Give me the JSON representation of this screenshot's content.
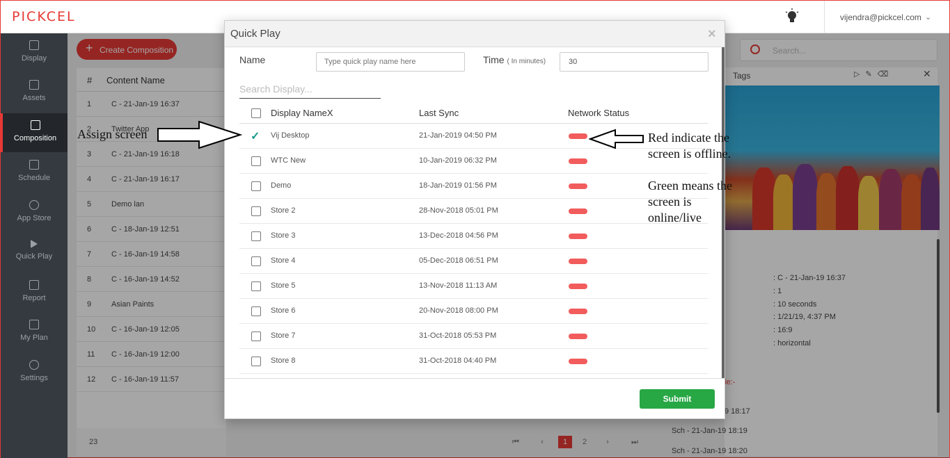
{
  "app": {
    "logo": "PICKCEL",
    "user_email": "vijendra@pickcel.com"
  },
  "sidebar": {
    "items": [
      {
        "label": "Display",
        "icon": "monitor-icon"
      },
      {
        "label": "Assets",
        "icon": "image-icon"
      },
      {
        "label": "Composition",
        "icon": "layout-icon",
        "active": true
      },
      {
        "label": "Schedule",
        "icon": "calendar-icon"
      },
      {
        "label": "App Store",
        "icon": "compass-icon"
      },
      {
        "label": "Quick Play",
        "icon": "play-icon"
      },
      {
        "label": "Report",
        "icon": "report-icon"
      },
      {
        "label": "My Plan",
        "icon": "diamond-icon"
      },
      {
        "label": "Settings",
        "icon": "gear-icon"
      }
    ]
  },
  "background": {
    "create_label": "Create Composition",
    "table_headers": [
      "#",
      "Content Name"
    ],
    "rows": [
      {
        "n": "1",
        "name": "C - 21-Jan-19 16:37"
      },
      {
        "n": "2",
        "name": "Twitter App"
      },
      {
        "n": "3",
        "name": "C - 21-Jan-19 16:18"
      },
      {
        "n": "4",
        "name": "C - 21-Jan-19 16:17"
      },
      {
        "n": "5",
        "name": "Demo lan"
      },
      {
        "n": "6",
        "name": "C - 18-Jan-19 12:51"
      },
      {
        "n": "7",
        "name": "C - 16-Jan-19 14:58"
      },
      {
        "n": "8",
        "name": "C - 16-Jan-19 14:52"
      },
      {
        "n": "9",
        "name": "Asian Paints"
      },
      {
        "n": "10",
        "name": "C - 16-Jan-19 12:05"
      },
      {
        "n": "11",
        "name": "C - 16-Jan-19 12:00"
      },
      {
        "n": "12",
        "name": "C - 16-Jan-19 11:57"
      }
    ],
    "total": "23",
    "pages": [
      "1",
      "2"
    ],
    "search_placeholder": "Search...",
    "tags_label": "Tags",
    "details": [
      ": C - 21-Jan-19 16:37",
      ": 1",
      ": 10 seconds",
      ": 1/21/19, 4:37 PM",
      ": 16:9",
      ": horizontal"
    ],
    "schedule_label": "le:-",
    "schedules": [
      "9 18:17",
      "Sch - 21-Jan-19 18:19",
      "Sch - 21-Jan-19 18:20"
    ]
  },
  "modal": {
    "title": "Quick Play",
    "name_label": "Name",
    "name_placeholder": "Type quick play name here",
    "time_label": "Time",
    "time_unit": "( In minutes)",
    "time_value": "30",
    "search_placeholder": "Search Display...",
    "columns": [
      "Display NameX",
      "Last Sync",
      "Network Status"
    ],
    "rows": [
      {
        "name": "Vij Desktop",
        "sync": "21-Jan-2019 04:50 PM",
        "checked": true
      },
      {
        "name": "WTC New",
        "sync": "10-Jan-2019 06:32 PM"
      },
      {
        "name": "Demo",
        "sync": "18-Jan-2019 01:56 PM"
      },
      {
        "name": "Store 2",
        "sync": "28-Nov-2018 05:01 PM"
      },
      {
        "name": "Store 3",
        "sync": "13-Dec-2018 04:56 PM"
      },
      {
        "name": "Store 4",
        "sync": "05-Dec-2018 06:51 PM"
      },
      {
        "name": "Store 5",
        "sync": "13-Nov-2018 11:13 AM"
      },
      {
        "name": "Store 6",
        "sync": "20-Nov-2018 08:00 PM"
      },
      {
        "name": "Store 7",
        "sync": "31-Oct-2018 05:53 PM"
      },
      {
        "name": "Store 8",
        "sync": "31-Oct-2018 04:40 PM"
      }
    ],
    "status_color": "#f25c5c",
    "submit_label": "Submit"
  },
  "annotations": {
    "assign": "Assign screen",
    "red_line1": "Red indicate the",
    "red_line2": "screen is offline.",
    "green_line1": "Green means the",
    "green_line2": "screen is",
    "green_line3": "online/live"
  }
}
